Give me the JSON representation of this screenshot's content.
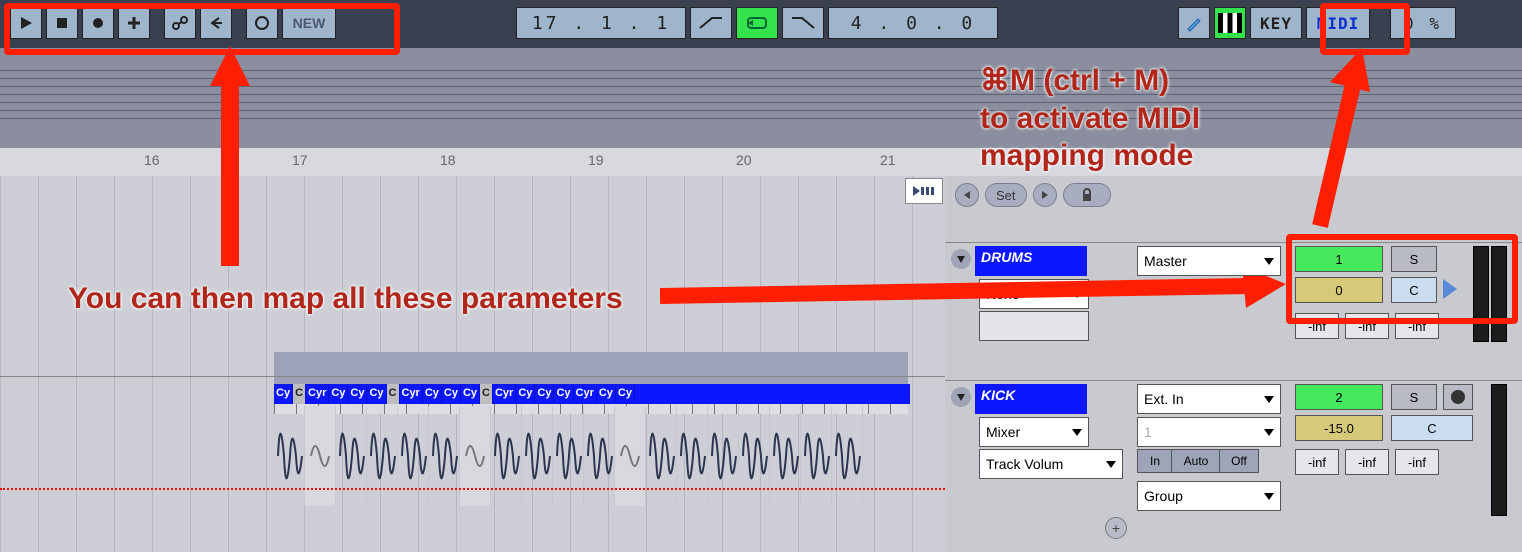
{
  "toolbar": {
    "play_icon": "play",
    "stop_icon": "stop",
    "record_icon": "record",
    "plus_icon": "plus",
    "key_icon": "key",
    "left_icon": "arrow-left",
    "punch_icon": "punch",
    "new_label": "NEW",
    "position": "17 .  1 .  1",
    "tempo": "4 .  0 .  0",
    "pencil_icon": "pencil",
    "piano_icon": "piano",
    "key_label": "KEY",
    "midi_label": "MIDI",
    "pct": "0 %"
  },
  "ruler": {
    "ticks": [
      "16",
      "17",
      "18",
      "19",
      "20",
      "21"
    ]
  },
  "loop": {
    "set_label": "Set"
  },
  "clips": {
    "labels": [
      "Cy",
      "C",
      "Cyr",
      "Cy",
      "Cy",
      "Cy",
      "C",
      "Cyr",
      "Cy",
      "Cy",
      "Cy",
      "C",
      "Cyr",
      "Cy",
      "Cy",
      "Cy",
      "Cyr",
      "Cy",
      "Cy"
    ]
  },
  "tracks": [
    {
      "name": "DRUMS",
      "routing": {
        "out": "Master",
        "in": "None"
      },
      "num": "1",
      "solo": "S",
      "delay": "0",
      "pan": "C",
      "sends": [
        "-inf",
        "-inf",
        "-inf"
      ]
    },
    {
      "name": "KICK",
      "routing": {
        "out": "Ext. In",
        "monitor": "Mixer",
        "mon_val": "1",
        "auto": "Track Volum",
        "group": "Group"
      },
      "num": "2",
      "solo": "S",
      "delay": "-15.0",
      "pan": "C",
      "mon_in": "In",
      "mon_auto": "Auto",
      "mon_off": "Off",
      "sends": [
        "-inf",
        "-inf",
        "-inf"
      ]
    }
  ],
  "annotations": {
    "top_right": "⌘M (ctrl + M)\nto activate MIDI\nmapping mode",
    "center": "You can then map all these parameters"
  }
}
